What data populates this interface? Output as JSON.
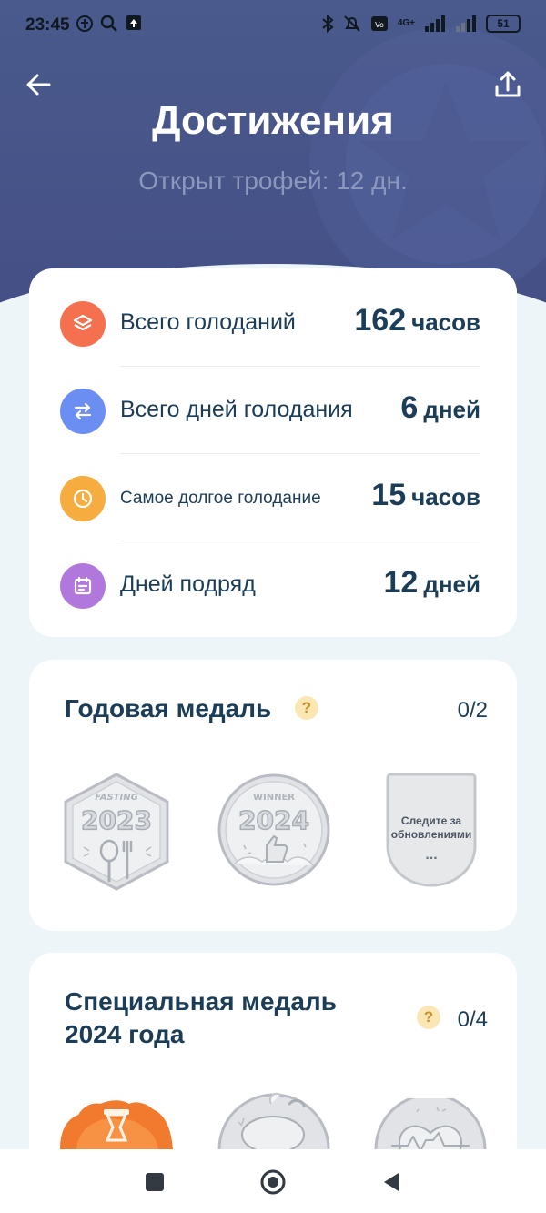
{
  "status_bar": {
    "time": "23:45",
    "battery": "51",
    "network": "4G+",
    "left_icons": [
      "sim-icon",
      "search-icon",
      "notification-icon"
    ],
    "right_icons": [
      "bluetooth-icon",
      "mute-icon",
      "volte-icon",
      "signal-icon",
      "signal-icon-2",
      "battery-icon"
    ]
  },
  "header": {
    "title": "Достижения",
    "subtitle": "Открыт трофей: 12 дн.",
    "back_icon": "arrow-left-icon",
    "share_icon": "share-icon"
  },
  "stats": [
    {
      "label": "Всего голоданий",
      "value": "162",
      "unit": "часов",
      "icon": "layers-icon",
      "color": "#f4704f"
    },
    {
      "label": "Всего дней голодания",
      "value": "6",
      "unit": "дней",
      "icon": "swap-icon",
      "color": "#6a8ef2"
    },
    {
      "label": "Самое долгое голодание",
      "value": "15",
      "unit": "часов",
      "icon": "clock-icon",
      "color": "#f6ac3f"
    },
    {
      "label": "Дней подряд",
      "value": "12",
      "unit": "дней",
      "icon": "calendar-icon",
      "color": "#b277dc"
    }
  ],
  "yearly_medal": {
    "title": "Годовая медаль",
    "count": "0/2",
    "medals": [
      {
        "top_text": "FASTING",
        "year": "2023"
      },
      {
        "top_text": "WINNER",
        "year": "2024"
      },
      {
        "text": "Следите за обновлениями",
        "dots": "..."
      }
    ]
  },
  "special_medal": {
    "title_line1": "Специальная медаль",
    "title_line2": "2024 года",
    "count": "0/4"
  },
  "nav": {
    "icons": [
      "recent-apps-icon",
      "home-icon",
      "back-icon"
    ]
  }
}
